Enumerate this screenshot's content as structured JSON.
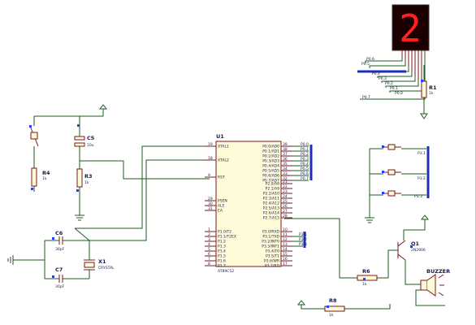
{
  "seg_display": {
    "digit": "2",
    "pin_labels": [
      "P0.6",
      "P0.5",
      "P0.4",
      "P0.3",
      "P0.2",
      "P0.1",
      "P0.0",
      "P0.7"
    ]
  },
  "r1": {
    "ref": "R1",
    "value": "1k"
  },
  "c5": {
    "ref": "C5",
    "value": "10u"
  },
  "r4": {
    "ref": "R4",
    "value": "1k"
  },
  "r3": {
    "ref": "R3",
    "value": "1k"
  },
  "c6": {
    "ref": "C6",
    "value": "30pF"
  },
  "c7": {
    "ref": "C7",
    "value": "30pF"
  },
  "x1": {
    "ref": "X1",
    "value": "CRYSTAL"
  },
  "mcu": {
    "ref": "U1",
    "part": "AT89C52",
    "left_pins": [
      {
        "num": "19",
        "name": "XTAL1"
      },
      {
        "num": "18",
        "name": "XTAL2"
      },
      {
        "num": "9",
        "name": "RST"
      },
      {
        "num": "29",
        "name": "PSEN"
      },
      {
        "num": "30",
        "name": "ALE"
      },
      {
        "num": "31",
        "name": "EA"
      },
      {
        "num": "1",
        "name": "P1.0/T2"
      },
      {
        "num": "2",
        "name": "P1.1/T2EX"
      },
      {
        "num": "3",
        "name": "P1.2"
      },
      {
        "num": "4",
        "name": "P1.3"
      },
      {
        "num": "5",
        "name": "P1.4"
      },
      {
        "num": "6",
        "name": "P1.5"
      },
      {
        "num": "7",
        "name": "P1.6"
      },
      {
        "num": "8",
        "name": "P1.7"
      }
    ],
    "right_pins": [
      {
        "num": "39",
        "name": "P0.0/AD0"
      },
      {
        "num": "38",
        "name": "P0.1/AD1"
      },
      {
        "num": "37",
        "name": "P0.2/AD2"
      },
      {
        "num": "36",
        "name": "P0.3/AD3"
      },
      {
        "num": "35",
        "name": "P0.4/AD4"
      },
      {
        "num": "34",
        "name": "P0.5/AD5"
      },
      {
        "num": "33",
        "name": "P0.6/AD6"
      },
      {
        "num": "32",
        "name": "P0.7/AD7"
      },
      {
        "num": "21",
        "name": "P2.0/A8"
      },
      {
        "num": "22",
        "name": "P2.1/A9"
      },
      {
        "num": "23",
        "name": "P2.2/A10"
      },
      {
        "num": "24",
        "name": "P2.3/A11"
      },
      {
        "num": "25",
        "name": "P2.4/A12"
      },
      {
        "num": "26",
        "name": "P2.5/A13"
      },
      {
        "num": "27",
        "name": "P2.6/A14"
      },
      {
        "num": "28",
        "name": "P2.7/A15"
      },
      {
        "num": "10",
        "name": "P3.0/RXD"
      },
      {
        "num": "11",
        "name": "P3.1/TXD"
      },
      {
        "num": "12",
        "name": "P3.2/INT0"
      },
      {
        "num": "13",
        "name": "P3.3/INT1"
      },
      {
        "num": "14",
        "name": "P3.4/T0"
      },
      {
        "num": "15",
        "name": "P3.5/T1"
      },
      {
        "num": "16",
        "name": "P3.6/WR"
      },
      {
        "num": "17",
        "name": "P3.7/RD"
      }
    ],
    "port0_bus_labels": [
      "P0.0",
      "P0.1",
      "P0.2",
      "P0.3",
      "P0.4",
      "P0.5",
      "P0.6",
      "P0.7"
    ],
    "port3_bus_labels": [
      "P3.1",
      "P3.2",
      "P3.3"
    ]
  },
  "switch_bus_labels": [
    "P3.1",
    "P3.2",
    "P3.3"
  ],
  "q1": {
    "ref": "Q1",
    "value": "2N2906"
  },
  "r6": {
    "ref": "R6",
    "value": "1k"
  },
  "r8": {
    "ref": "R8",
    "value": "1k"
  },
  "buzzer": {
    "ref": "BUZZER"
  },
  "colors": {
    "wire": "#1e5a1e",
    "component": "#7a1a1a",
    "fill": "#fffbd9",
    "bus": "#1f2fb4",
    "text": "#1a1a4a",
    "segment_on": "#ff2020",
    "segment_off": "#5a0000",
    "display_bg": "#1a0000",
    "pin_marker": "#2040ff"
  }
}
